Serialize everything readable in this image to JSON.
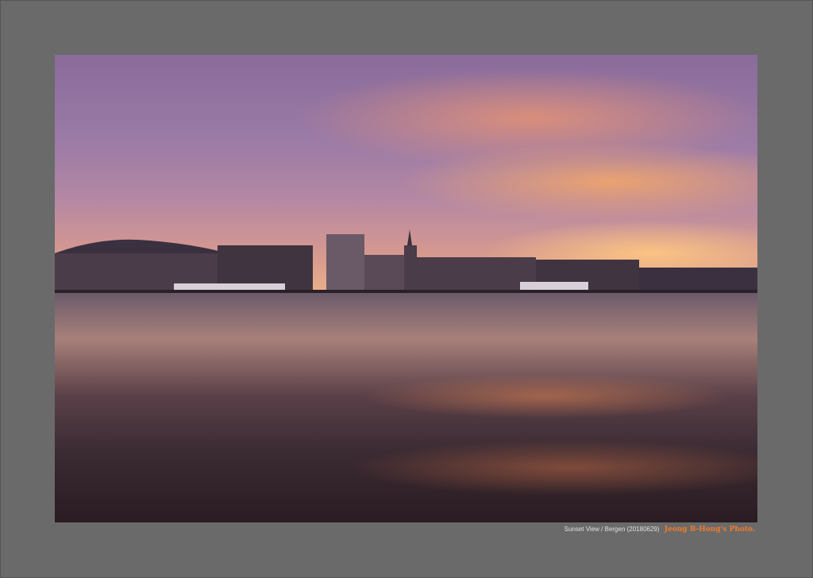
{
  "photo": {
    "subject": "sunset-harbor"
  },
  "caption": {
    "text": "Sunset View / Bergen  (20180629)",
    "signature": "Jeong B-Hong's Photo."
  },
  "colors": {
    "frame": "#6a6a6a",
    "signature": "#f07a2a"
  }
}
